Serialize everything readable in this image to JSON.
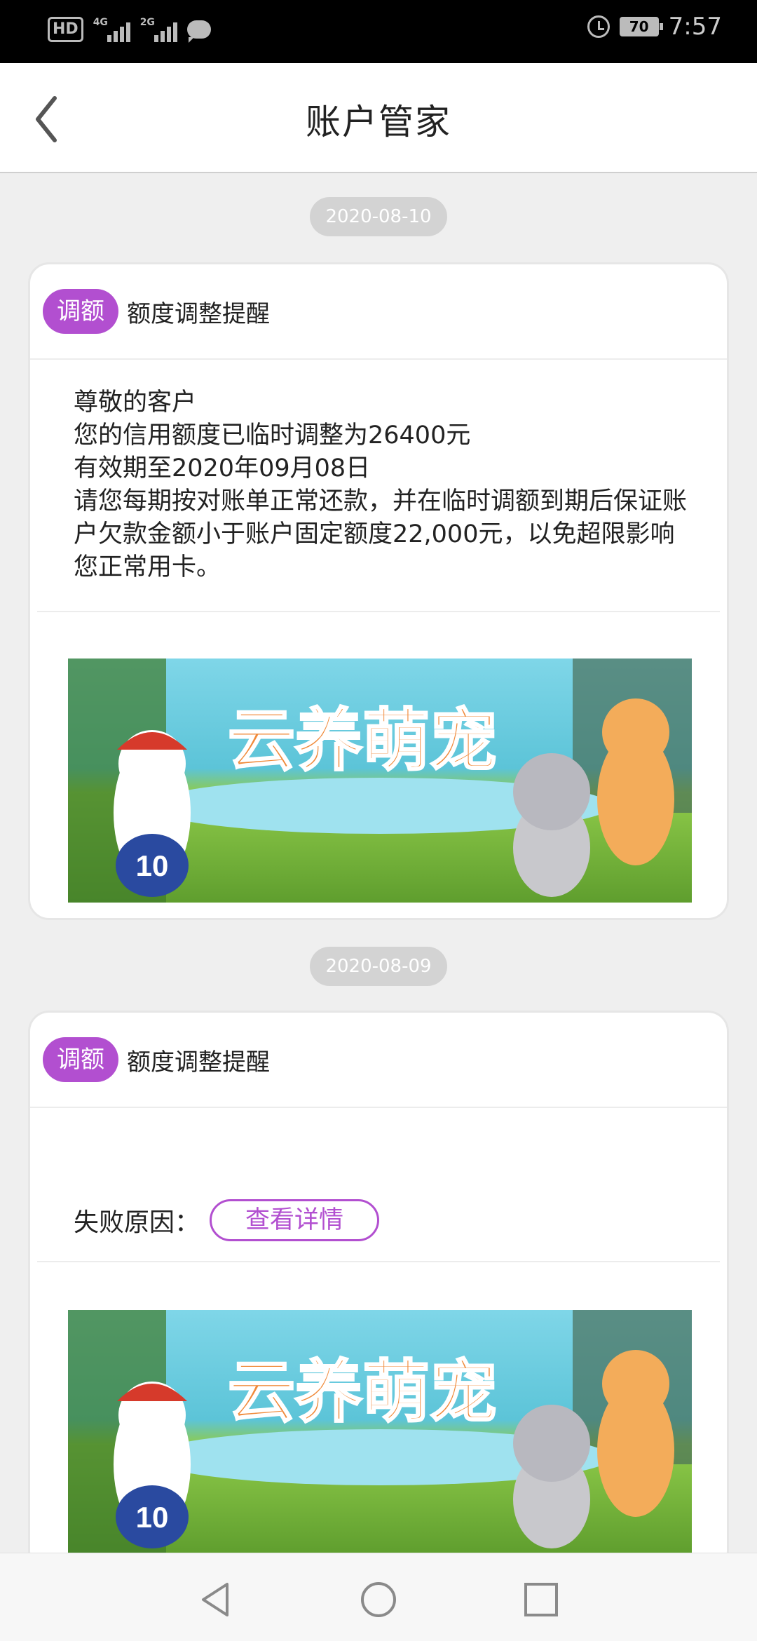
{
  "status_bar": {
    "hd_label": "HD",
    "net1": "4G",
    "net2": "2G",
    "battery": "70",
    "time": "7:57"
  },
  "header": {
    "title": "账户管家"
  },
  "messages": [
    {
      "date": "2020-08-10",
      "badge": "调额",
      "title": "额度调整提醒",
      "lines": [
        "尊敬的客户",
        "您的信用额度已临时调整为26400元",
        "有效期至2020年09月08日",
        "请您每期按对账单正常还款，并在临时调额到期后保证账户欠款金额小于账户固定额度22,000元，以免超限影响您正常用卡。"
      ],
      "banner_text": "云养萌宠",
      "banner_jersey": "10"
    },
    {
      "date": "2020-08-09",
      "badge": "调额",
      "title": "额度调整提醒",
      "fail_label": "失败原因：",
      "detail_button": "查看详情",
      "banner_text": "云养萌宠",
      "banner_jersey": "10"
    }
  ],
  "colors": {
    "accent": "#b24fd0",
    "background": "#efefef"
  },
  "navbar": {
    "icons": [
      "back-triangle-icon",
      "home-circle-icon",
      "recents-square-icon"
    ]
  }
}
